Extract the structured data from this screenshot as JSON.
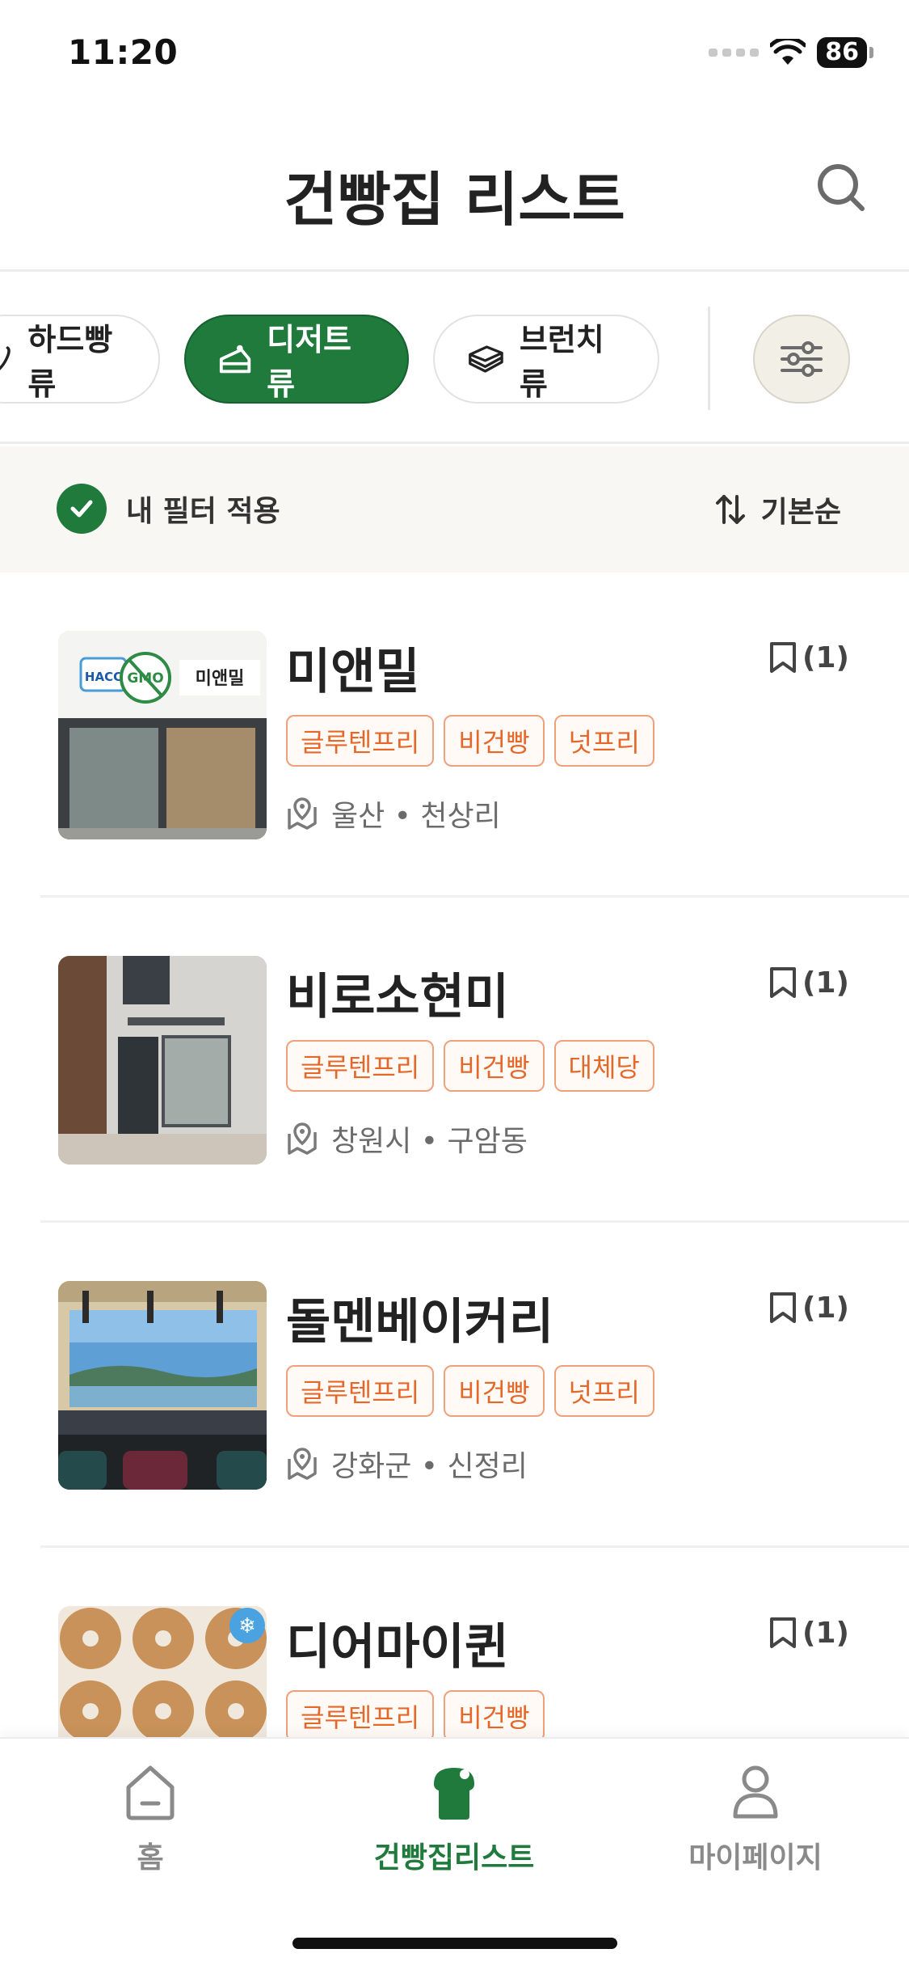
{
  "status_bar": {
    "time": "11:20",
    "battery": "86"
  },
  "header": {
    "title": "건빵집 리스트"
  },
  "categories": [
    {
      "label": "하드빵류",
      "active": false
    },
    {
      "label": "디저트류",
      "active": true
    },
    {
      "label": "브런치류",
      "active": false
    }
  ],
  "filter_bar": {
    "my_filter_label": "내 필터 적용",
    "sort_label": "기본순"
  },
  "bakeries": [
    {
      "name": "미앤밀",
      "bookmark_count": "(1)",
      "tags": [
        "글루텐프리",
        "비건빵",
        "넛프리"
      ],
      "location": "울산 • 천상리"
    },
    {
      "name": "비로소현미",
      "bookmark_count": "(1)",
      "tags": [
        "글루텐프리",
        "비건빵",
        "대체당"
      ],
      "location": "창원시 • 구암동"
    },
    {
      "name": "돌멘베이커리",
      "bookmark_count": "(1)",
      "tags": [
        "글루텐프리",
        "비건빵",
        "넛프리"
      ],
      "location": "강화군 • 신정리"
    },
    {
      "name": "디어마이퀸",
      "bookmark_count": "(1)",
      "tags": [
        "글루텐프리",
        "비건빵"
      ],
      "location": ""
    }
  ],
  "thumb_texts": {
    "hacc": "HACC",
    "gmo": "GMO",
    "sign": "미앤밀"
  },
  "bottom_nav": {
    "home": "홈",
    "list": "건빵집리스트",
    "my": "마이페이지"
  },
  "colors": {
    "brand_green": "#1f7a3c",
    "tag_orange": "#e4682a"
  }
}
